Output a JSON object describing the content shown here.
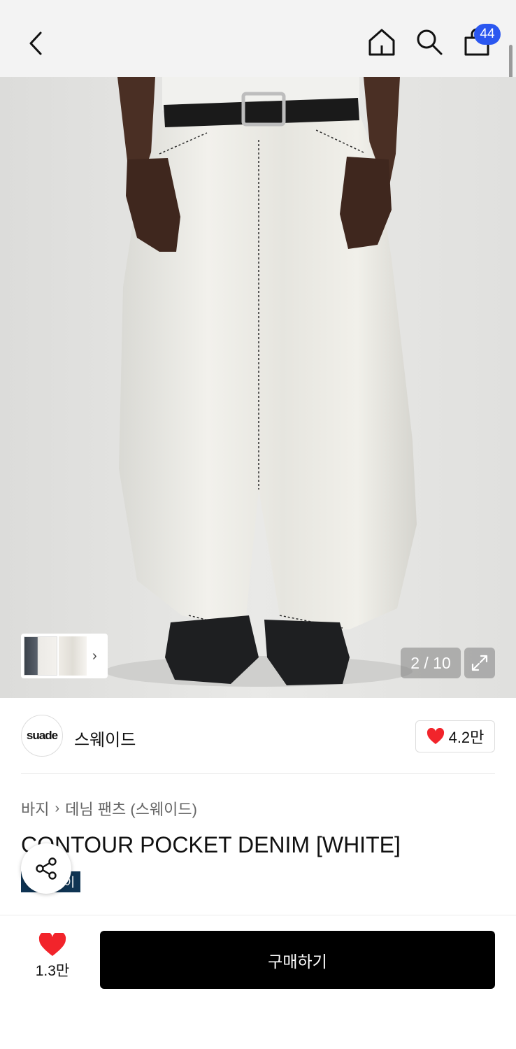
{
  "header": {
    "back_icon": "chevron-left-icon",
    "home_icon": "home-icon",
    "search_icon": "search-icon",
    "cart_icon": "shopping-bag-icon",
    "cart_count": "44"
  },
  "gallery": {
    "counter": "2 / 10",
    "expand_icon": "expand-icon",
    "thumb_arrow": "›"
  },
  "brand": {
    "logo_text": "suade",
    "name": "스웨이드",
    "likes": "4.2만"
  },
  "product": {
    "breadcrumb": [
      "바지",
      "데님 팬츠 (스웨이드)"
    ],
    "title": "CONTOUR POCKET DENIM [WHITE]",
    "pay_badge": "페이"
  },
  "footer": {
    "wish_count": "1.3만",
    "buy_label": "구매하기"
  },
  "colors": {
    "badge_blue": "#2b57f0",
    "heart_red": "#f2242b",
    "pay_navy": "#0f3453"
  }
}
